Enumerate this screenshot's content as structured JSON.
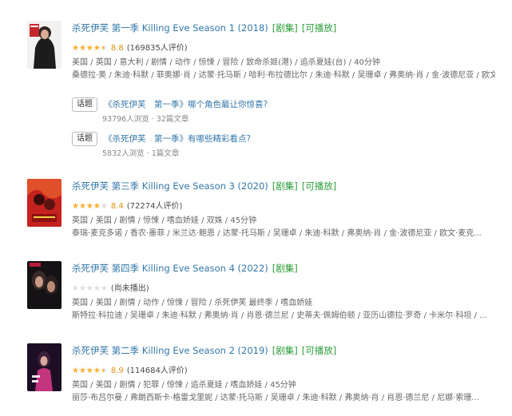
{
  "items": [
    {
      "title": "杀死伊芙 第一季 Killing Eve Season 1 (2018)",
      "tags": [
        "[剧集]",
        "[可播放]"
      ],
      "stars": 4.5,
      "score": "8.8",
      "count": "(169835人评价)",
      "genre": "美国 / 英国 / 意大利 / 剧情 / 动作 / 惊悚 / 冒险 / 致命杀姬(港) / 追杀夏娃(台) / 40分钟",
      "cast": "桑德拉·奥 / 朱迪·科默 / 菲奥娜·肖 / 达蒙·托马斯 / 哈利·布拉德比尔 / 朱迪·科默 / 吴珊卓 / 弗奥纳·肖 / 金·波德尼亚 / 欧文·麦克唐纳 / 肖恩 ...",
      "topics": [
        {
          "badge": "话题",
          "text": "《杀死伊芙　第一季》哪个角色最让你惊喜?",
          "stats": "93796人浏览 · 32篇文章"
        },
        {
          "badge": "话题",
          "text": "《杀死伊芙　第一季》有哪些精彩看点?",
          "stats": "5832人浏览 · 1篇文章"
        }
      ]
    },
    {
      "title": "杀死伊芙 第三季 Killing Eve Season 3 (2020)",
      "tags": [
        "[剧集]",
        "[可播放]"
      ],
      "stars": 4,
      "score": "8.4",
      "count": "(72274人评价)",
      "genre": "英国 / 美国 / 剧情 / 惊悚 / 嗜血娇娃 / 双姝 / 45分钟",
      "cast": "泰瑞·麦克多诺 / 香农·墨菲 / 米兰达·鲍恩 / 达蒙·托马斯 / 吴珊卓 / 朱迪·科默 / 弗奥纳·肖 / 金·波德尼亚 / 欧文·麦克...",
      "topics": []
    },
    {
      "title": "杀死伊芙 第四季 Killing Eve Season 4 (2022)",
      "tags": [
        "[剧集]"
      ],
      "stars": 0,
      "score": "",
      "count": "(尚未播出)",
      "genre": "英国 / 美国 / 剧情 / 动作 / 惊悚 / 冒险 / 杀死伊芙 最终季 / 嗜血娇娃",
      "cast": "斯特拉·科拉迪 / 吴珊卓 / 朱迪·科默 / 弗奥纳·肖 / 肖恩·德兰尼 / 史蒂夫·佩姆伯顿 / 亚历山德拉·罗奇 / 卡米尔·科坦 / ...",
      "topics": []
    },
    {
      "title": "杀死伊芙 第二季 Killing Eve Season 2 (2019)",
      "tags": [
        "[剧集]",
        "[可播放]"
      ],
      "stars": 4.5,
      "score": "8.9",
      "count": "(114684人评价)",
      "genre": "英国 / 美国 / 剧情 / 犯罪 / 惊悚 / 追杀夏娃 / 嗜血娇娃 / 45分钟",
      "cast": "丽莎·布吕尔曼 / 弗朗西斯卡·格雷戈里妮 / 达蒙·托马斯 / 吴珊卓 / 朱迪·科默 / 弗奥纳·肖 / 肖恩·德兰尼 / 尼娜·索珊...",
      "topics": []
    }
  ]
}
